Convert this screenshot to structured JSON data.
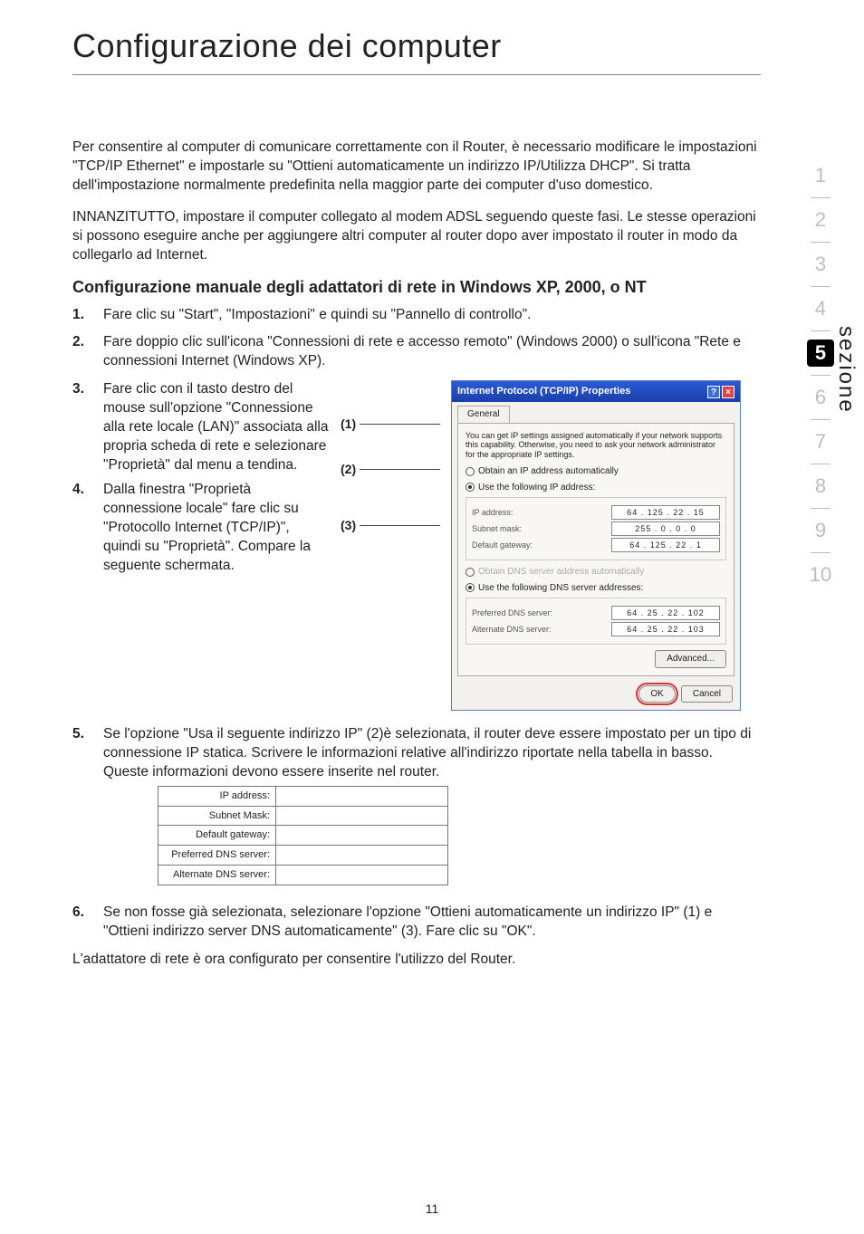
{
  "page": {
    "title": "Configurazione dei computer",
    "number": "11"
  },
  "sideLabel": "sezione",
  "nav": [
    "1",
    "2",
    "3",
    "4",
    "5",
    "6",
    "7",
    "8",
    "9",
    "10"
  ],
  "navCurrent": "5",
  "para1": "Per consentire al computer di comunicare correttamente con il Router, è necessario modificare le impostazioni \"TCP/IP Ethernet\" e impostarle su \"Ottieni automaticamente un indirizzo IP/Utilizza DHCP\". Si tratta dell'impostazione normalmente predefinita nella maggior parte dei computer d'uso domestico.",
  "para2": "INNANZITUTTO, impostare il computer collegato al modem ADSL seguendo queste fasi. Le stesse operazioni si possono eseguire anche per aggiungere altri computer al router dopo aver impostato il router in modo da collegarlo ad Internet.",
  "subhead": "Configurazione manuale degli adattatori di rete in Windows XP, 2000, o NT",
  "steps": {
    "s1": "Fare clic su \"Start\", \"Impostazioni\" e quindi su \"Pannello di controllo\".",
    "s2": "Fare doppio clic sull'icona \"Connessioni di rete e accesso remoto\" (Windows 2000) o sull'icona \"Rete e connessioni Internet (Windows XP).",
    "s3a": "Fare clic con il tasto destro del mouse sull'opzione \"Connessione alla rete locale (LAN)\" associata alla propria scheda di rete e selezionare \"Proprietà\" dal menu a tendina.",
    "s4": "Dalla finestra \"Proprietà connessione locale\" fare clic su \"Protocollo Internet (TCP/IP)\", quindi su \"Proprietà\". Compare la seguente schermata.",
    "s5": "Se l'opzione \"Usa il seguente indirizzo IP\" (2)è selezionata, il router deve essere impostato per un tipo di connessione IP statica. Scrivere le informazioni relative all'indirizzo riportate nella tabella in basso. Queste informazioni devono essere inserite nel router.",
    "s6": "Se non fosse già selezionata, selezionare l'opzione \"Ottieni automaticamente un indirizzo IP\" (1) e \"Ottieni indirizzo server DNS automaticamente\" (3). Fare clic su \"OK\"."
  },
  "callouts": {
    "c1": "(1)",
    "c2": "(2)",
    "c3": "(3)"
  },
  "closing": "L'adattatore di rete è ora configurato per consentire l'utilizzo del Router.",
  "dialog": {
    "title": "Internet Protocol (TCP/IP) Properties",
    "tab": "General",
    "desc": "You can get IP settings assigned automatically if your network supports this capability. Otherwise, you need to ask your network administrator for the appropriate IP settings.",
    "radioAuto": "Obtain an IP address automatically",
    "radioUse": "Use the following IP address:",
    "ipLabel": "IP address:",
    "ipVal": "64 . 125 . 22 . 15",
    "subnetLabel": "Subnet mask:",
    "subnetVal": "255 . 0 . 0 . 0",
    "gwLabel": "Default gateway:",
    "gwVal": "64 . 125 . 22 . 1",
    "dnsAuto": "Obtain DNS server address automatically",
    "dnsUse": "Use the following DNS server addresses:",
    "prefDnsLabel": "Preferred DNS server:",
    "prefDnsVal": "64 . 25 . 22 . 102",
    "altDnsLabel": "Alternate DNS server:",
    "altDnsVal": "64 . 25 . 22 . 103",
    "adv": "Advanced...",
    "ok": "OK",
    "cancel": "Cancel"
  },
  "ipTable": {
    "r1": "IP address:",
    "r2": "Subnet Mask:",
    "r3": "Default gateway:",
    "r4": "Preferred DNS server:",
    "r5": "Alternate DNS server:"
  }
}
